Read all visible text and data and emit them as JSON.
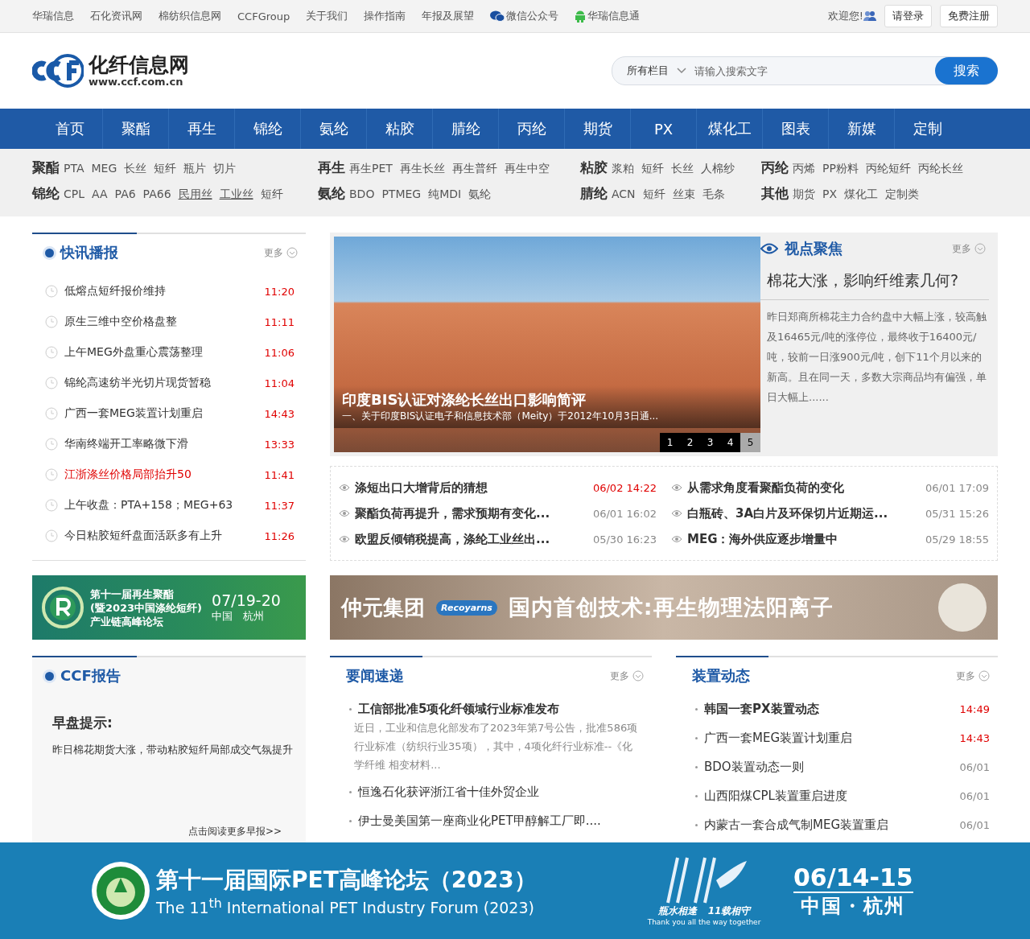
{
  "topbar": {
    "links": [
      {
        "label": "华瑞信息",
        "kind": "text"
      },
      {
        "label": "石化资讯网",
        "kind": "text"
      },
      {
        "label": "棉纺织信息网",
        "kind": "text"
      },
      {
        "label": "CCFGroup",
        "kind": "text"
      },
      {
        "label": "关于我们",
        "kind": "text"
      },
      {
        "label": "操作指南",
        "kind": "text"
      },
      {
        "label": "年报及展望",
        "kind": "text"
      },
      {
        "label": "微信公众号",
        "kind": "wechat"
      },
      {
        "label": "华瑞信息通",
        "kind": "android"
      }
    ],
    "welcome": "欢迎您!",
    "login": "请登录",
    "register": "免费注册"
  },
  "header": {
    "logo_title": "化纤信息网",
    "logo_url": "www.ccf.com.cn",
    "search_scope": "所有栏目",
    "search_placeholder": "请输入搜索文字",
    "search_button": "搜索"
  },
  "nav": [
    {
      "label": "首页",
      "selected": false
    },
    {
      "label": "聚酯",
      "selected": false
    },
    {
      "label": "再生",
      "selected": false
    },
    {
      "label": "锦纶",
      "selected": false
    },
    {
      "label": "氨纶",
      "selected": false
    },
    {
      "label": "粘胶",
      "selected": false
    },
    {
      "label": "腈纶",
      "selected": false
    },
    {
      "label": "丙纶",
      "selected": false
    },
    {
      "label": "期货",
      "selected": false
    },
    {
      "label": "PX",
      "selected": false
    },
    {
      "label": "煤化工",
      "selected": false
    },
    {
      "label": "图表",
      "selected": false
    },
    {
      "label": "新媒",
      "selected": false
    },
    {
      "label": "定制",
      "selected": false
    }
  ],
  "categories": [
    [
      {
        "head": "聚酯",
        "items": [
          "PTA",
          "MEG",
          "长丝",
          "短纤",
          "瓶片",
          "切片"
        ]
      },
      {
        "head": "锦纶",
        "items": [
          "CPL",
          "AA",
          "PA6",
          "PA66",
          "民用丝",
          "工业丝",
          "短纤"
        ]
      }
    ],
    [
      {
        "head": "再生",
        "items": [
          "再生PET",
          "再生长丝",
          "再生普纤",
          "再生中空"
        ]
      },
      {
        "head": "氨纶",
        "items": [
          "BDO",
          "PTMEG",
          "纯MDI",
          "氨纶"
        ]
      }
    ],
    [
      {
        "head": "粘胶",
        "items": [
          "浆粕",
          "短纤",
          "长丝",
          "人棉纱"
        ]
      },
      {
        "head": "腈纶",
        "items": [
          "ACN",
          "短纤",
          "丝束",
          "毛条"
        ]
      }
    ],
    [
      {
        "head": "丙纶",
        "items": [
          "丙烯",
          "PP粉料",
          "丙纶短纤",
          "丙纶长丝"
        ]
      },
      {
        "head": "其他",
        "items": [
          "期货",
          "PX",
          "煤化工",
          "定制类"
        ]
      }
    ]
  ],
  "flash": {
    "title": "快讯播报",
    "more": "更多",
    "items": [
      {
        "text": "低熔点短纤报价维持",
        "time": "11:20",
        "highlight": false
      },
      {
        "text": "原生三维中空价格盘整",
        "time": "11:11",
        "highlight": false
      },
      {
        "text": "上午MEG外盘重心震荡整理",
        "time": "11:06",
        "highlight": false
      },
      {
        "text": "锦纶高速纺半光切片现货暂稳",
        "time": "11:04",
        "highlight": false
      },
      {
        "text": "广西一套MEG装置计划重启",
        "time": "14:43",
        "highlight": false
      },
      {
        "text": "华南终端开工率略微下滑",
        "time": "13:33",
        "highlight": false
      },
      {
        "text": "江浙涤丝价格局部抬升50",
        "time": "11:41",
        "highlight": true
      },
      {
        "text": "上午收盘：PTA+158；MEG+63",
        "time": "11:37",
        "highlight": false
      },
      {
        "text": "今日粘胶短纤盘面活跃多有上升",
        "time": "11:26",
        "highlight": false
      }
    ]
  },
  "slider": {
    "caption_title": "印度BIS认证对涤纶长丝出口影响简评",
    "caption_text": "一、关于印度BIS认证电子和信息技术部（Meity）于2012年10月3日通...",
    "pages": [
      {
        "label": "1",
        "selected": false
      },
      {
        "label": "2",
        "selected": false
      },
      {
        "label": "3",
        "selected": false
      },
      {
        "label": "4",
        "selected": false
      },
      {
        "label": "5",
        "selected": true
      }
    ]
  },
  "viewpoint": {
    "title": "视点聚焦",
    "more": "更多",
    "headline": "棉花大涨，影响纤维素几何?",
    "summary": "昨日郑商所棉花主力合约盘中大幅上涨，较高触及16465元/吨的涨停位，最终收于16400元/吨，较前一日涨900元/吨，创下11个月以来的新高。且在同一天，多数大宗商品均有偏强，单日大幅上......"
  },
  "featured": [
    {
      "text": "涤短出口大增背后的猜想",
      "time": "06/02 14:22",
      "highlight": true
    },
    {
      "text": "从需求角度看聚酯负荷的变化",
      "time": "06/01 17:09",
      "highlight": false
    },
    {
      "text": "聚酯负荷再提升，需求预期有变化...",
      "time": "06/01 16:02",
      "highlight": false
    },
    {
      "text": "白瓶砖、3A白片及环保切片近期运...",
      "time": "05/31 15:26",
      "highlight": false
    },
    {
      "text": "欧盟反倾销税提高，涤纶工业丝出...",
      "time": "05/30 16:23",
      "highlight": false
    },
    {
      "text": "MEG：海外供应逐步增量中",
      "time": "05/29 18:55",
      "highlight": false
    }
  ],
  "ads": {
    "left": {
      "title": "第十一届再生聚酯",
      "subtitle": "(暨2023中国涤纶短纤)",
      "line3": "产业链高峰论坛",
      "date": "07/19-20",
      "place": "中国　杭州"
    },
    "right": {
      "brand": "仲元集团",
      "badge": "Recoyarns",
      "slogan": "国内首创技术:再生物理法阳离子"
    }
  },
  "report": {
    "title": "CCF报告",
    "heading": "早盘提示:",
    "body": "昨日棉花期货大涨，带动粘胶短纤局部成交气氛提升",
    "more": "点击阅读更多早报>>"
  },
  "news": {
    "title": "要闻速递",
    "more": "更多",
    "lead": {
      "text": "工信部批准5项化纤领域行业标准发布",
      "summary": "近日，工业和信息化部发布了2023年第7号公告，批准586项行业标准（纺织行业35项），其中，4项化纤行业标准--《化学纤维 相变材料..."
    },
    "items": [
      "恒逸石化获评浙江省十佳外贸企业",
      "伊士曼美国第一座商业化PET甲醇解工厂即...."
    ]
  },
  "plants": {
    "title": "装置动态",
    "more": "更多",
    "items": [
      {
        "text": "韩国一套PX装置动态",
        "time": "14:49",
        "highlight": true
      },
      {
        "text": "广西一套MEG装置计划重启",
        "time": "14:43",
        "highlight": true
      },
      {
        "text": "BDO装置动态一则",
        "time": "06/01",
        "highlight": false
      },
      {
        "text": "山西阳煤CPL装置重启进度",
        "time": "06/01",
        "highlight": false
      },
      {
        "text": "内蒙古一套合成气制MEG装置重启",
        "time": "06/01",
        "highlight": false
      }
    ]
  },
  "float_banner": {
    "title": "第十一届国际PET高峰论坛（2023）",
    "subtitle": "The 11$^{th}$ International PET Industry Forum (2023)",
    "tag1": "瓶水相逢",
    "tag2": "11载相守",
    "tag3": "Thank you all the way together",
    "date": "06/14-15",
    "place": "中国・杭州"
  }
}
